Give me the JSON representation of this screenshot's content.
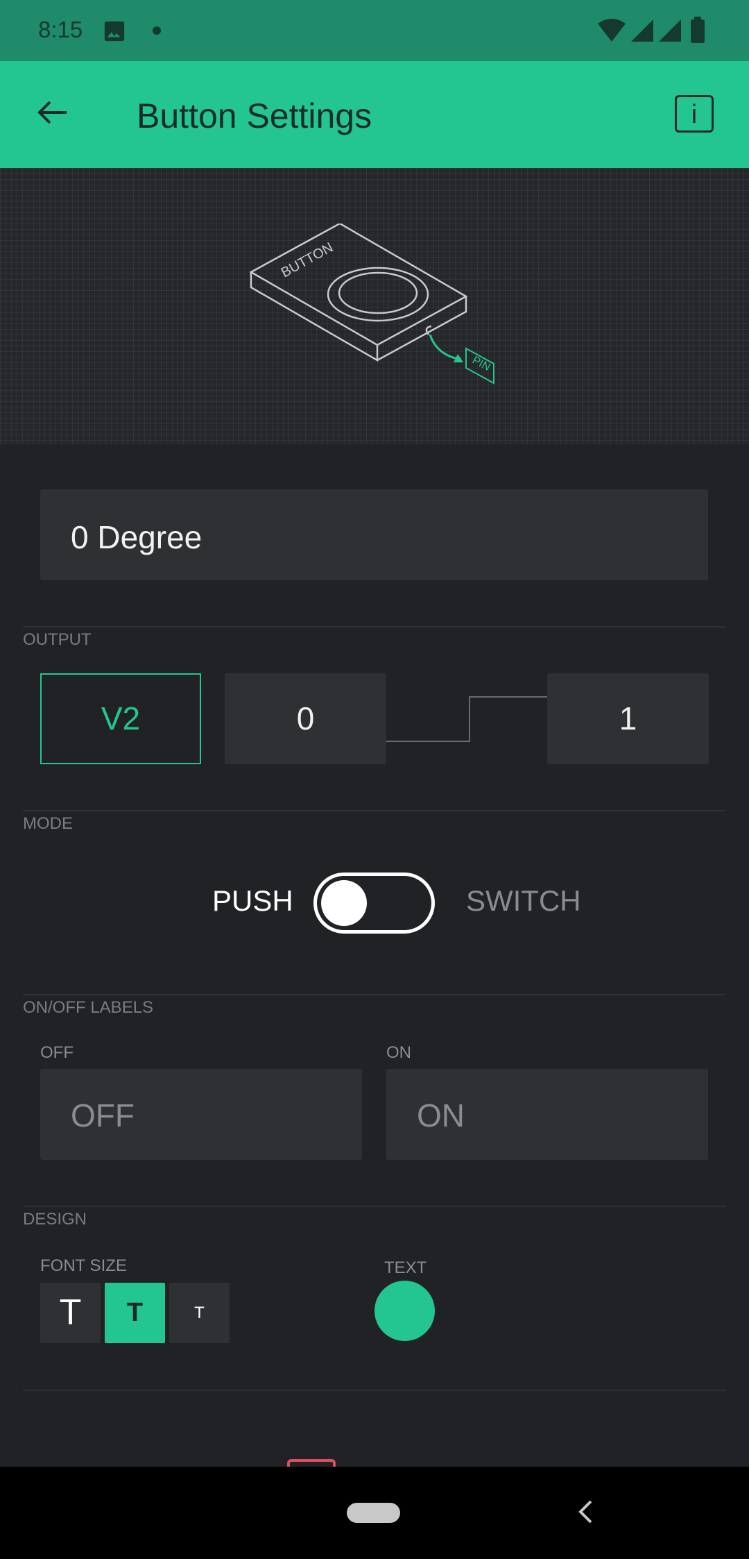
{
  "status_bar": {
    "time": "8:15"
  },
  "app_bar": {
    "title": "Button Settings",
    "info_label": "i"
  },
  "widget": {
    "name": "0 Degree"
  },
  "output": {
    "section_label": "OUTPUT",
    "pin": "V2",
    "low_value": "0",
    "high_value": "1"
  },
  "mode": {
    "section_label": "MODE",
    "push_label": "PUSH",
    "switch_label": "SWITCH",
    "selected": "PUSH"
  },
  "onoff_labels": {
    "section_label": "ON/OFF LABELS",
    "off_label": "OFF",
    "off_placeholder": "OFF",
    "on_label": "ON",
    "on_placeholder": "ON"
  },
  "design": {
    "section_label": "DESIGN",
    "font_size_label": "FONT SIZE",
    "font_sizes": [
      "T",
      "T",
      "T"
    ],
    "text_label": "TEXT",
    "text_color": "#23c690"
  },
  "colors": {
    "accent": "#23c690",
    "status_bar": "#1f8b6a",
    "background": "#212226"
  }
}
